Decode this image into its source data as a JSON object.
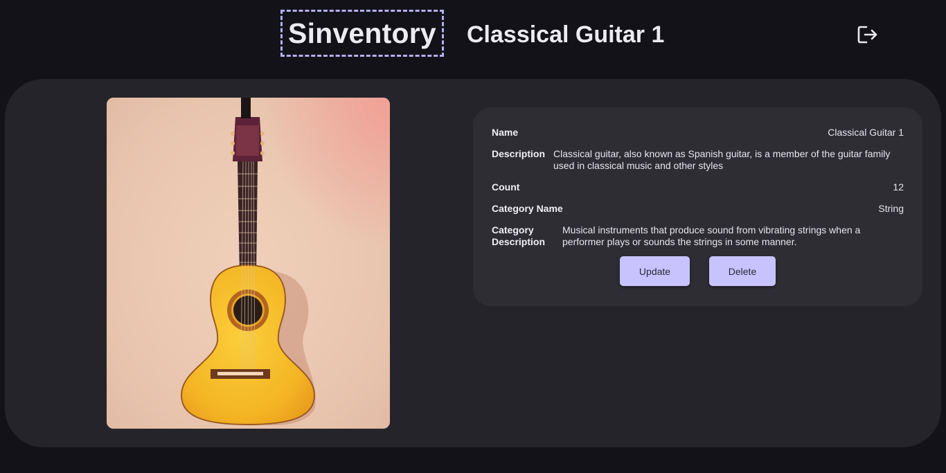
{
  "header": {
    "logo_text": "Sinventory",
    "page_title": "Classical Guitar 1"
  },
  "icons": {
    "logout": "logout-icon"
  },
  "item": {
    "image_alt": "classical guitar photo",
    "fields": {
      "name_label": "Name",
      "name_value": "Classical Guitar 1",
      "description_label": "Description",
      "description_value": "Classical guitar, also known as Spanish guitar, is a member of the guitar family used in classical music and other styles",
      "count_label": "Count",
      "count_value": "12",
      "category_name_label": "Category Name",
      "category_name_value": "String",
      "category_description_label": "Category Description",
      "category_description_value": "Musical instruments that produce sound from vibrating strings when a performer plays or sounds the strings in some manner."
    },
    "actions": {
      "update_label": "Update",
      "delete_label": "Delete"
    }
  },
  "colors": {
    "background": "#131218",
    "panel": "#25242b",
    "card": "#2e2d34",
    "accent": "#c8c3fd",
    "logo_border": "#b4aef2"
  }
}
